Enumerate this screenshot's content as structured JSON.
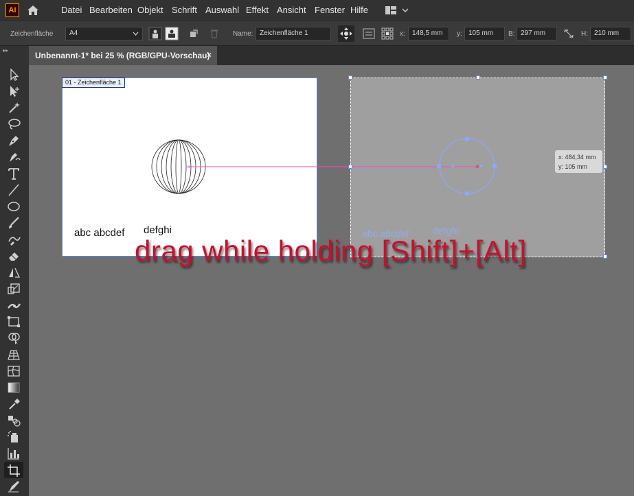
{
  "app": {
    "logo": "Ai"
  },
  "menu": [
    "Datei",
    "Bearbeiten",
    "Objekt",
    "Schrift",
    "Auswahl",
    "Effekt",
    "Ansicht",
    "Fenster",
    "Hilfe"
  ],
  "control_bar": {
    "mode_label": "Zeichenfläche",
    "preset": "A4",
    "name_label": "Name:",
    "name_value": "Zeichenfläche 1",
    "x_label": "x:",
    "x_value": "148,5 mm",
    "y_label": "y:",
    "y_value": "105 mm",
    "w_label": "B:",
    "w_value": "297 mm",
    "h_label": "H:",
    "h_value": "210 mm"
  },
  "document_tab": {
    "title": "Unbenannt-1* bei 25 % (RGB/GPU-Vorschau)",
    "close": "×"
  },
  "artboard": {
    "label": "01 - Zeichenfläche 1",
    "text1": "abc abcdef",
    "text2": "defghi"
  },
  "ghost": {
    "text1": "abc abcdef",
    "text2": "defghi"
  },
  "tooltip": {
    "x": "x: 484,34 mm",
    "y": "y: 105 mm"
  },
  "overlay_text": "drag while holding [Shift]+[Alt]",
  "tools": [
    "selection-tool",
    "direct-selection-tool",
    "magic-wand-tool",
    "lasso-tool",
    "pen-tool",
    "curvature-tool",
    "type-tool",
    "line-tool",
    "ellipse-tool",
    "paintbrush-tool",
    "shaper-tool",
    "eraser-tool",
    "rotate-tool",
    "scale-tool",
    "width-tool",
    "free-transform-tool",
    "shape-builder-tool",
    "perspective-grid-tool",
    "mesh-tool",
    "gradient-tool",
    "eyedropper-tool",
    "blend-tool",
    "symbol-sprayer-tool",
    "graph-tool",
    "artboard-tool",
    "slice-tool"
  ],
  "colors": {
    "accent": "#ff9a00",
    "selection": "#5a8ae0",
    "smart_guide": "#ff44cc",
    "overlay": "#c8102e"
  }
}
